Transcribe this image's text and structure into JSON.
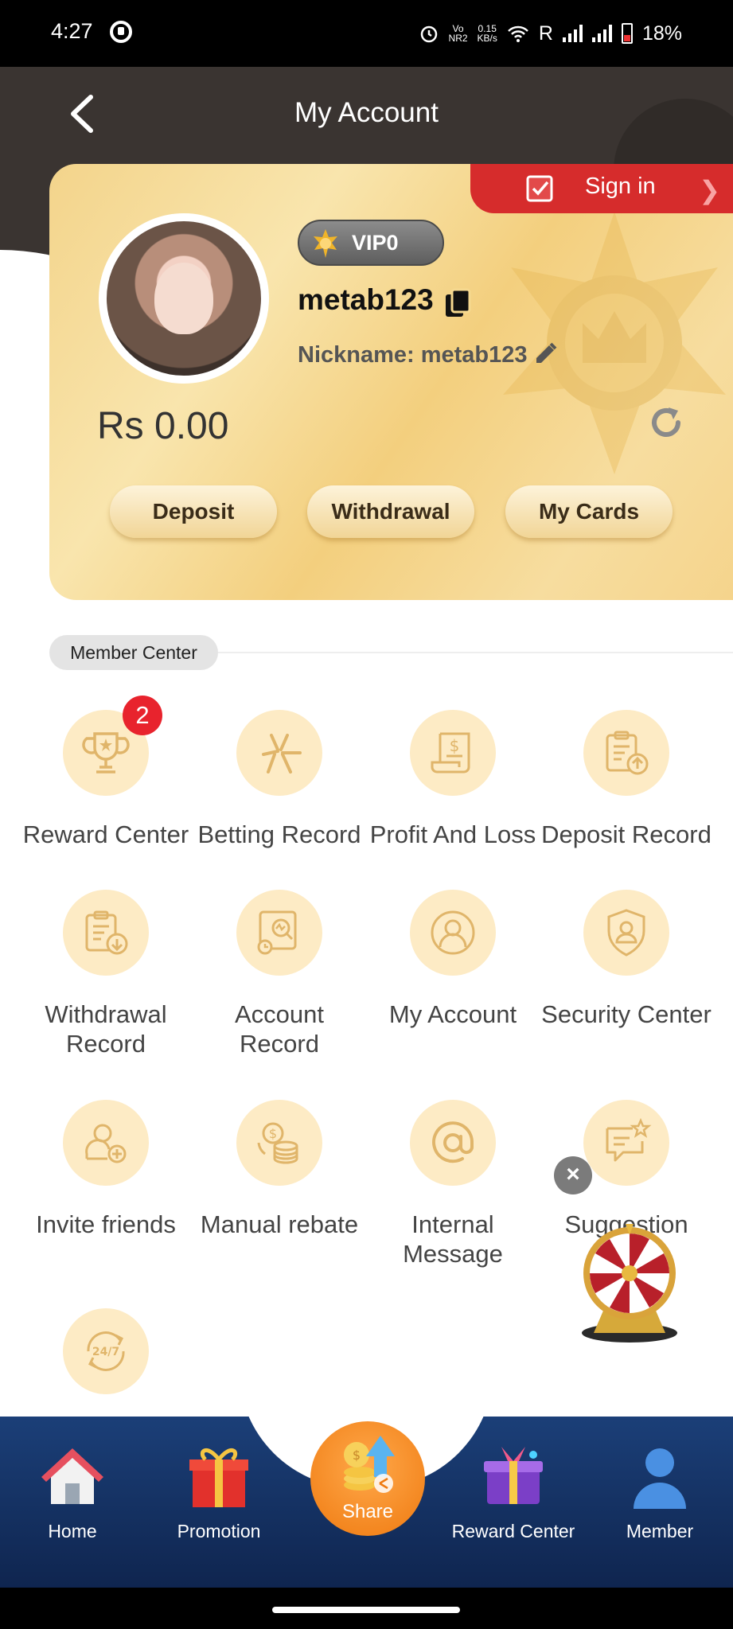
{
  "status_bar": {
    "time": "4:27",
    "network_speed_value": "0.15",
    "network_speed_unit": "KB/s",
    "volte": "Vo",
    "nr": "NR2",
    "roaming": "R",
    "battery": "18%"
  },
  "header": {
    "title": "My Account"
  },
  "account_card": {
    "sign_in_label": "Sign in",
    "vip_label": "VIP0",
    "username": "metab123",
    "nickname": "Nickname: metab123",
    "balance": "Rs  0.00",
    "deposit_label": "Deposit",
    "withdrawal_label": "Withdrawal",
    "my_cards_label": "My Cards"
  },
  "member_center": {
    "title": "Member Center",
    "reward_badge": "2",
    "items": [
      {
        "label": "Reward Center",
        "icon": "trophy-icon"
      },
      {
        "label": "Betting Record",
        "icon": "betting-icon"
      },
      {
        "label": "Profit And Loss",
        "icon": "receipt-icon"
      },
      {
        "label": "Deposit Record",
        "icon": "deposit-clipboard-icon"
      },
      {
        "label": "Withdrawal Record",
        "icon": "withdrawal-clipboard-icon"
      },
      {
        "label": "Account Record",
        "icon": "account-record-icon"
      },
      {
        "label": "My Account",
        "icon": "user-circle-icon"
      },
      {
        "label": "Security Center",
        "icon": "shield-user-icon"
      },
      {
        "label": "Invite friends",
        "icon": "invite-user-icon"
      },
      {
        "label": "Manual rebate",
        "icon": "coins-icon"
      },
      {
        "label": "Internal Message",
        "icon": "at-icon"
      },
      {
        "label": "Suggestion",
        "icon": "chat-star-icon"
      },
      {
        "label": "",
        "icon": "support-24-7-icon"
      }
    ],
    "support_icon_text": "24/7"
  },
  "floating": {
    "close_symbol": "×"
  },
  "bottom_nav": {
    "home": "Home",
    "promotion": "Promotion",
    "share": "Share",
    "reward_center": "Reward Center",
    "member": "Member"
  },
  "colors": {
    "accent_red": "#d62c2c",
    "icon_bg": "#fdebc5",
    "icon_stroke": "#e0b56a",
    "nav_bg": "#0f254f",
    "share_orange": "#ef7a10"
  }
}
